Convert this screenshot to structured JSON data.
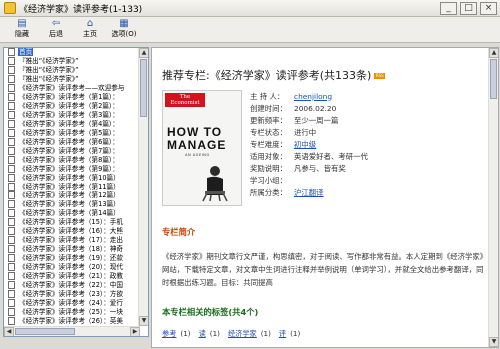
{
  "window": {
    "title": "《经济学家》读评参考(1-133)"
  },
  "window_controls": {
    "minimize": "_",
    "maximize": "□",
    "close": "×"
  },
  "toolbar": [
    {
      "label": "隐藏",
      "icon": "hide-icon",
      "glyph": "▤"
    },
    {
      "label": "后退",
      "icon": "back-arrow-icon",
      "glyph": "⇦"
    },
    {
      "label": "主页",
      "icon": "home-icon",
      "glyph": "⌂"
    },
    {
      "label": "选项(O)",
      "icon": "options-icon",
      "glyph": "▦"
    }
  ],
  "tree": {
    "items": [
      "首页",
      "『推出“《经济学家》”",
      "『推出“《经济学家》”",
      "『推出“《经济学家》”",
      "《经济学家》读评参考——欢迎参与",
      "《经济学家》读评参考（第1篇）：",
      "《经济学家》读评参考（第2篇）：",
      "《经济学家》读评参考（第3篇）：",
      "《经济学家》读评参考（第4篇）：",
      "《经济学家》读评参考（第5篇）：",
      "《经济学家》读评参考（第6篇）：",
      "《经济学家》读评参考（第7篇）：",
      "《经济学家》读评参考（第8篇）：",
      "《经济学家》读评参考（第9篇）：",
      "《经济学家》读评参考（第10篇）",
      "《经济学家》读评参考（第11篇）",
      "《经济学家》读评参考（第12篇）",
      "《经济学家》读评参考（第13篇）",
      "《经济学家》读评参考（第14篇）",
      "《经济学家》读评参考（15）：手机",
      "《经济学家》读评参考（16）：大熊",
      "《经济学家》读评参考（17）：走出",
      "《经济学家》读评参考（18）：神奇",
      "《经济学家》读评参考（19）：还款",
      "《经济学家》读评参考（20）：现代",
      "《经济学家》读评参考（21）：政教",
      "《经济学家》读评参考（22）：中国",
      "《经济学家》读评参考（23）：方欲",
      "《经济学家》读评参考（24）：爱行",
      "《经济学家》读评参考（25）：一块",
      "《经济学家》读评参考（26）：英美",
      "《经济学家》读评参考（27）：是新",
      "《经济学家》读评参考（28）：新疆"
    ]
  },
  "article": {
    "title": "推荐专栏:《经济学家》读评参考(共133条)",
    "badge": "RSS",
    "cover": {
      "masthead_line1": "The",
      "masthead_line2": "Economist",
      "headline": "HOW TO MANAGE",
      "subline": "AN AGEING"
    },
    "info": [
      {
        "key": "主 持 人：",
        "value": "chenjilong",
        "is_link": true
      },
      {
        "key": "创建时间：",
        "value": "2006.02.20",
        "is_link": false
      },
      {
        "key": "更新频率：",
        "value": "至少一周一篇",
        "is_link": false
      },
      {
        "key": "专栏状态：",
        "value": "进行中",
        "is_link": false
      },
      {
        "key": "专栏难度：",
        "value": "初中级",
        "is_link": true
      },
      {
        "key": "适用对象：",
        "value": "英语爱好者、考研一代",
        "is_link": false
      },
      {
        "key": "奖励说明：",
        "value": "凡参与、皆有奖",
        "is_link": false
      },
      {
        "key": "学习小组：",
        "value": "",
        "is_link": false
      },
      {
        "key": "所属分类：",
        "value": "沪江翻译",
        "is_link": true
      }
    ],
    "intro_heading": "专栏简介",
    "intro_text": "《经济学家》期刊文章行文严谨，构思缜密，对于阅读、写作都非常有益。本人定期到《经济学家》网站，下载特定文章，对文章中生词进行注释并举例说明（单词学习），并就全文给出参考翻译，同时根据出练习题。目标：共同提高",
    "tags_heading": "本专栏相关的标签(共4个)",
    "tags": [
      {
        "name": "参考",
        "count": "(1)"
      },
      {
        "name": "读",
        "count": "(1)"
      },
      {
        "name": "经济学家",
        "count": "(1)"
      },
      {
        "name": "评",
        "count": "(1)"
      }
    ]
  }
}
